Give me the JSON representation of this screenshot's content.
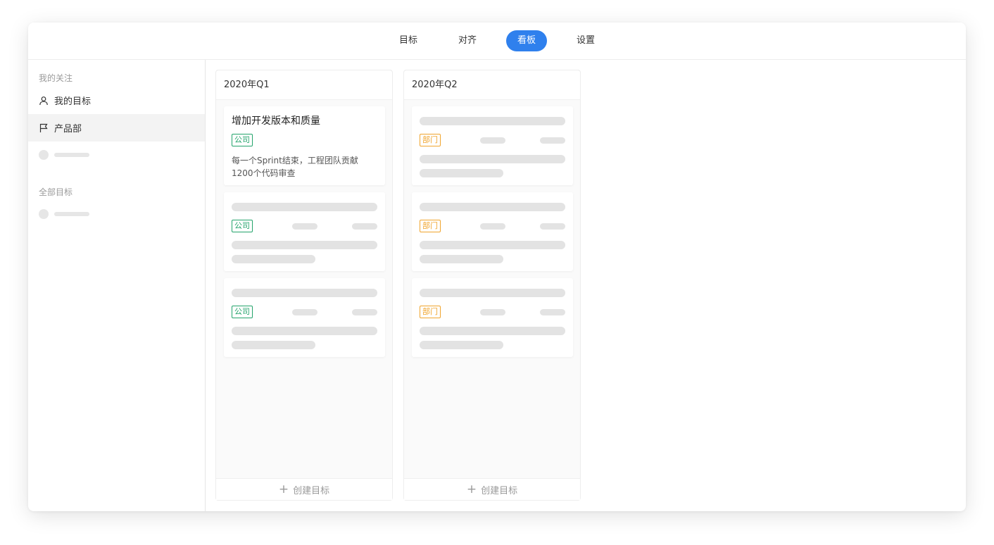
{
  "nav": {
    "tabs": [
      {
        "label": "目标"
      },
      {
        "label": "对齐"
      },
      {
        "label": "看板"
      },
      {
        "label": "设置"
      }
    ],
    "active_index": 2
  },
  "sidebar": {
    "section_follow": "我的关注",
    "my_goals": "我的目标",
    "product_dept": "产品部",
    "section_all": "全部目标"
  },
  "columns": [
    {
      "title": "2020年Q1",
      "create_label": "创建目标",
      "cards": [
        {
          "title": "增加开发版本和质量",
          "tag": "公司",
          "description": "每一个Sprint结束，工程团队贡献1200个代码审查"
        },
        {
          "tag": "公司"
        },
        {
          "tag": "公司"
        }
      ]
    },
    {
      "title": "2020年Q2",
      "create_label": "创建目标",
      "cards": [
        {
          "tag": "部门"
        },
        {
          "tag": "部门"
        },
        {
          "tag": "部门"
        }
      ]
    }
  ],
  "colors": {
    "accent": "#2f80ed",
    "tag_company": "#22a36a",
    "tag_department": "#f0a42c",
    "skeleton": "#e3e3e3"
  }
}
